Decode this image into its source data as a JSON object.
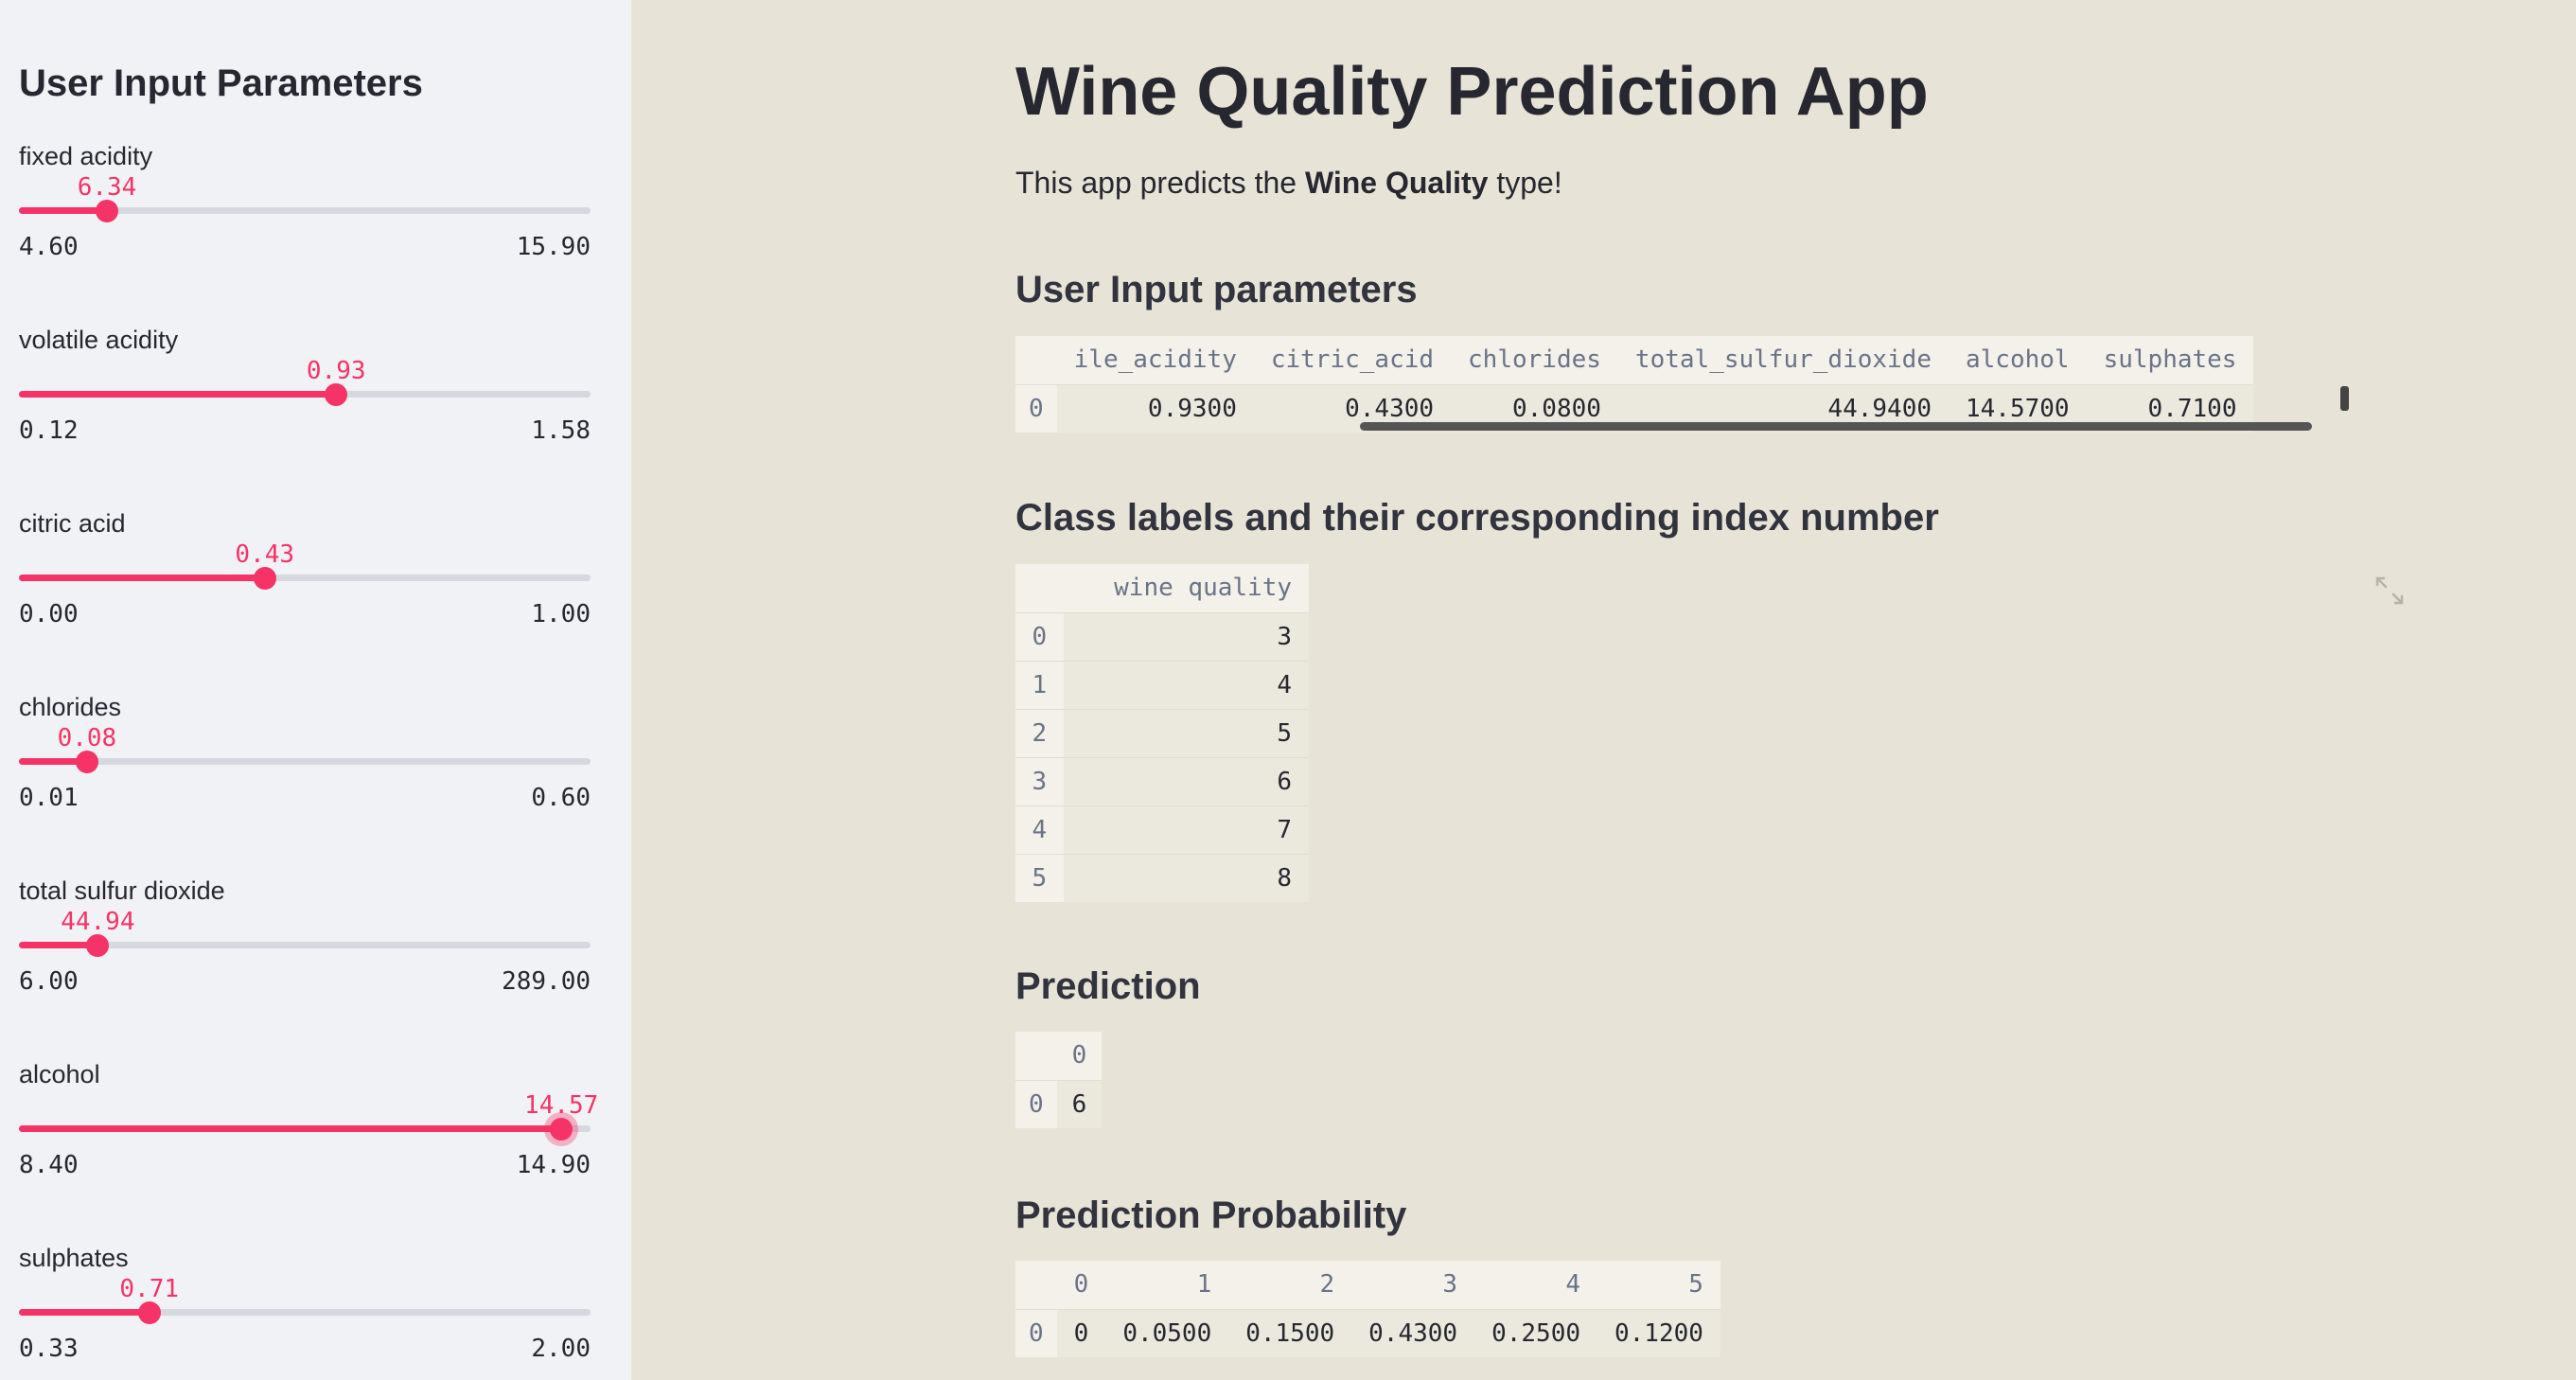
{
  "sidebar": {
    "title": "User Input Parameters",
    "sliders": [
      {
        "label": "fixed acidity",
        "value": "6.34",
        "min": "4.60",
        "max": "15.90",
        "fraction": 0.154
      },
      {
        "label": "volatile acidity",
        "value": "0.93",
        "min": "0.12",
        "max": "1.58",
        "fraction": 0.555
      },
      {
        "label": "citric acid",
        "value": "0.43",
        "min": "0.00",
        "max": "1.00",
        "fraction": 0.43
      },
      {
        "label": "chlorides",
        "value": "0.08",
        "min": "0.01",
        "max": "0.60",
        "fraction": 0.119
      },
      {
        "label": "total sulfur dioxide",
        "value": "44.94",
        "min": "6.00",
        "max": "289.00",
        "fraction": 0.138
      },
      {
        "label": "alcohol",
        "value": "14.57",
        "min": "8.40",
        "max": "14.90",
        "fraction": 0.949
      },
      {
        "label": "sulphates",
        "value": "0.71",
        "min": "0.33",
        "max": "2.00",
        "fraction": 0.228
      }
    ]
  },
  "main": {
    "title": "Wine Quality Prediction App",
    "intro_before": "This app predicts the ",
    "intro_bold": "Wine Quality",
    "intro_after": " type!",
    "input_heading": "User Input parameters",
    "input_table": {
      "columns": [
        "ile_acidity",
        "citric_acid",
        "chlorides",
        "total_sulfur_dioxide",
        "alcohol",
        "sulphates"
      ],
      "rows": [
        {
          "index": "0",
          "cells": [
            "0.9300",
            "0.4300",
            "0.0800",
            "44.9400",
            "14.5700",
            "0.7100"
          ]
        }
      ]
    },
    "class_heading": "Class labels and their corresponding index number",
    "class_table": {
      "columns": [
        "wine quality"
      ],
      "rows": [
        {
          "index": "0",
          "cells": [
            "3"
          ]
        },
        {
          "index": "1",
          "cells": [
            "4"
          ]
        },
        {
          "index": "2",
          "cells": [
            "5"
          ]
        },
        {
          "index": "3",
          "cells": [
            "6"
          ]
        },
        {
          "index": "4",
          "cells": [
            "7"
          ]
        },
        {
          "index": "5",
          "cells": [
            "8"
          ]
        }
      ]
    },
    "prediction_heading": "Prediction",
    "prediction_table": {
      "columns": [
        "0"
      ],
      "rows": [
        {
          "index": "0",
          "cells": [
            "6"
          ]
        }
      ]
    },
    "probability_heading": "Prediction Probability",
    "probability_table": {
      "columns": [
        "0",
        "1",
        "2",
        "3",
        "4",
        "5"
      ],
      "rows": [
        {
          "index": "0",
          "cells": [
            "0",
            "0.0500",
            "0.1500",
            "0.4300",
            "0.2500",
            "0.1200"
          ]
        }
      ]
    }
  },
  "icons": {
    "expand": "expand-icon"
  },
  "colors": {
    "accent": "#f63366",
    "sidebar_bg": "#f1f2f5",
    "main_bg": "#e7e3d6"
  }
}
